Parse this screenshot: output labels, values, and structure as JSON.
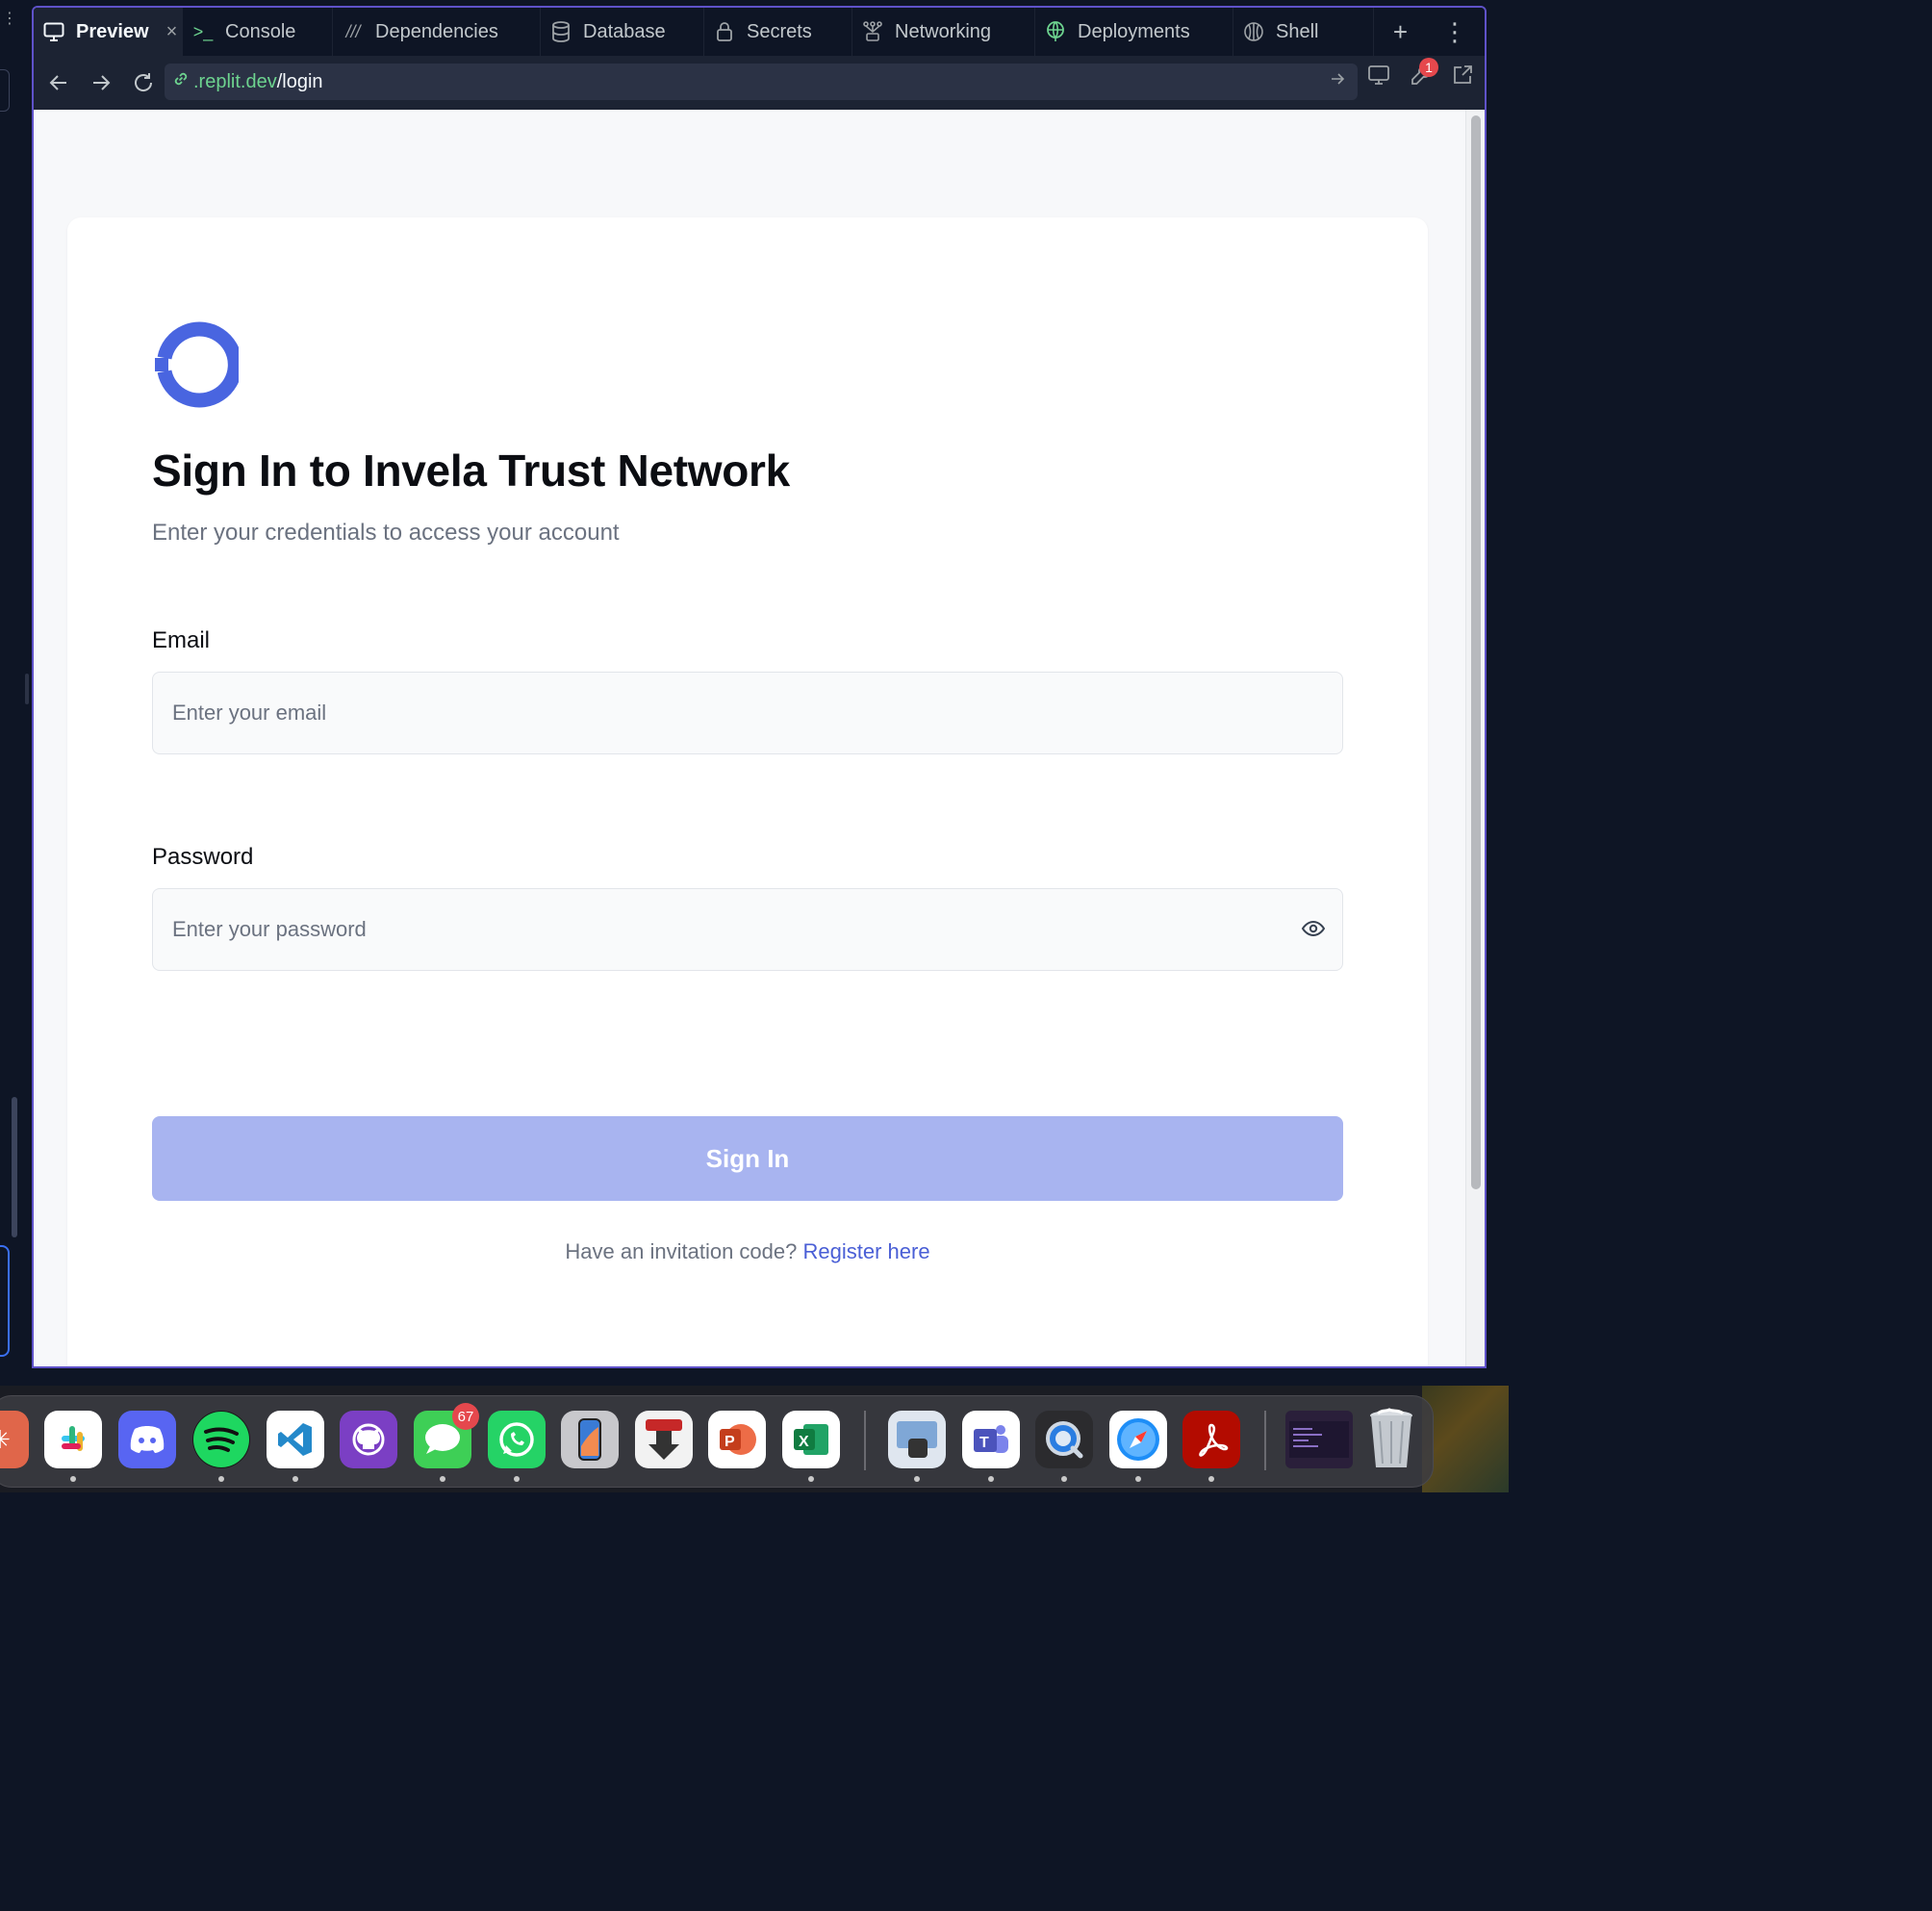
{
  "tabs": [
    {
      "label": "Preview",
      "icon": "monitor-icon",
      "active": true
    },
    {
      "label": "Console",
      "icon": "terminal-icon"
    },
    {
      "label": "Dependencies",
      "icon": "dependencies-icon"
    },
    {
      "label": "Database",
      "icon": "database-icon"
    },
    {
      "label": "Secrets",
      "icon": "lock-icon"
    },
    {
      "label": "Networking",
      "icon": "network-icon"
    },
    {
      "label": "Deployments",
      "icon": "deploy-icon"
    },
    {
      "label": "Shell",
      "icon": "shell-icon"
    }
  ],
  "tab_actions": {
    "add": "+",
    "more": "⋮"
  },
  "url": {
    "host": ".replit.dev",
    "path": "/login"
  },
  "devtools_badge": "1",
  "login": {
    "title": "Sign In to Invela Trust Network",
    "subtitle": "Enter your credentials to access your account",
    "email_label": "Email",
    "email_placeholder": "Enter your email",
    "password_label": "Password",
    "password_placeholder": "Enter your password",
    "signin_label": "Sign In",
    "footer_text": "Have an invitation code? ",
    "footer_link": "Register here"
  },
  "brand_color": "#4a5fd6",
  "dock": {
    "messages_badge": "67",
    "apps": [
      "Slack",
      "Discord",
      "Spotify",
      "Visual Studio Code",
      "GitHub Desktop",
      "Messages",
      "WhatsApp",
      "iPhone Mirroring",
      "Transmit",
      "PowerPoint",
      "Excel",
      "Preview",
      "Teams",
      "QuickTime",
      "Safari",
      "Acrobat",
      "Trash"
    ]
  }
}
